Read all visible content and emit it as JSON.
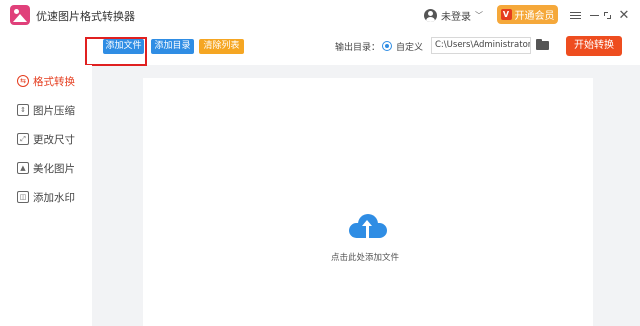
{
  "app": {
    "title": "优速图片格式转换器"
  },
  "account": {
    "login_label": "未登录",
    "vip_label": "开通会员",
    "vip_badge": "V"
  },
  "window_controls": [
    "menu-icon",
    "minimize-icon",
    "maximize-icon",
    "close-icon"
  ],
  "toolbar": {
    "add_file_label": "添加文件",
    "add_dir_label": "添加目录",
    "clear_label": "清除列表",
    "output_label": "输出目录：",
    "output_option_label": "自定义",
    "output_path": "C:\\Users\\Administrator\\",
    "start_label": "开始转换"
  },
  "sidebar": {
    "items": [
      {
        "label": "格式转换",
        "icon": "convert-icon",
        "active": true
      },
      {
        "label": "图片压缩",
        "icon": "compress-icon",
        "active": false
      },
      {
        "label": "更改尺寸",
        "icon": "resize-icon",
        "active": false
      },
      {
        "label": "美化图片",
        "icon": "beautify-icon",
        "active": false
      },
      {
        "label": "添加水印",
        "icon": "watermark-icon",
        "active": false
      }
    ]
  },
  "main": {
    "drop_hint": "点击此处添加文件"
  },
  "colors": {
    "accent_blue": "#2f8de4",
    "accent_orange": "#f5a623",
    "start_red": "#ee4d1f",
    "active_red": "#e53d1f",
    "highlight_red": "#e02020"
  }
}
